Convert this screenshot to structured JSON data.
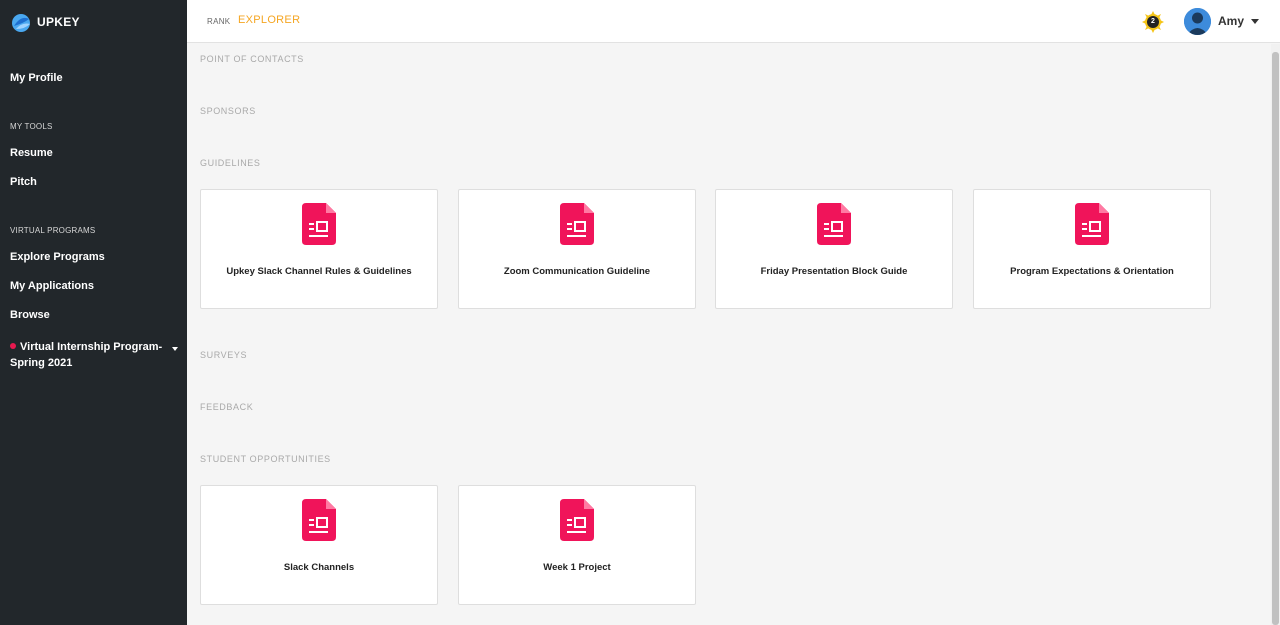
{
  "app": {
    "brand": "UPKEY"
  },
  "header": {
    "rank_label": "RANK",
    "rank_value": "EXPLORER",
    "notification_count": "2",
    "user_name": "Amy"
  },
  "sidebar": {
    "my_profile": "My Profile",
    "my_tools_section": "MY TOOLS",
    "resume": "Resume",
    "pitch": "Pitch",
    "virtual_programs_section": "VIRTUAL PROGRAMS",
    "explore_programs": "Explore Programs",
    "my_applications": "My Applications",
    "browse": "Browse",
    "program_line1": "Virtual Internship Program-",
    "program_line2": "Spring 2021"
  },
  "sections": {
    "point_of_contacts": "POINT OF CONTACTS",
    "sponsors": "SPONSORS",
    "guidelines": "GUIDELINES",
    "surveys": "SURVEYS",
    "feedback": "FEEDBACK",
    "student_opportunities": "STUDENT OPPORTUNITIES"
  },
  "guidelines_cards": [
    "Upkey Slack Channel Rules & Guidelines",
    "Zoom Communication Guideline",
    "Friday Presentation Block Guide",
    "Program Expectations & Orientation"
  ],
  "opportunity_cards": [
    "Slack Channels",
    "Week 1 Project"
  ],
  "colors": {
    "sidebar_bg": "#22272b",
    "accent_rank": "#f5a623",
    "doc_icon": "#f0145a",
    "program_dot": "#e8194f"
  }
}
